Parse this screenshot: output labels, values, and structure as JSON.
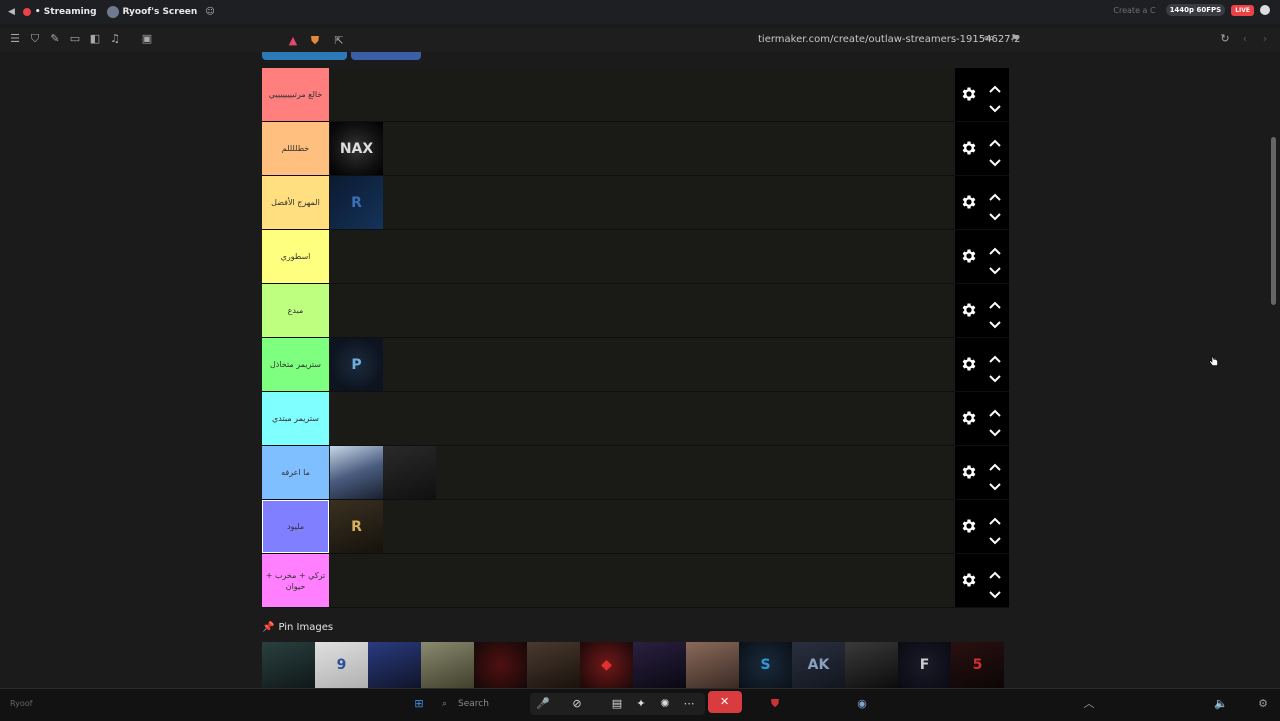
{
  "discord_bar": {
    "stream_label": "• Streaming",
    "screen_label": "Ryoof's Screen",
    "create_text": "Create a C",
    "quality": "1440p 60FPS",
    "live": "LIVE"
  },
  "browser": {
    "url": "tiermaker.com/create/outlaw-streamers-19154627-2"
  },
  "tiers": [
    {
      "label": "خالع مرتبيييييييي",
      "color": "#ff7f7f",
      "items": []
    },
    {
      "label": "خطللللم",
      "color": "#ffbf7f",
      "items": [
        "nax-logo"
      ]
    },
    {
      "label": "المهرج الأفضل",
      "color": "#ffdf7f",
      "items": [
        "blue-r-logo"
      ]
    },
    {
      "label": "اسطوري",
      "color": "#ffff7f",
      "items": []
    },
    {
      "label": "مبدع",
      "color": "#bfff7f",
      "items": []
    },
    {
      "label": "ستريمر متخاذل",
      "color": "#7fff7f",
      "items": [
        "pd-logo"
      ]
    },
    {
      "label": "ستريمر مبتدي",
      "color": "#7fffff",
      "items": []
    },
    {
      "label": "ما اعرفه",
      "color": "#7fbfff",
      "items": [
        "anime-avatar",
        "dark-avatar"
      ]
    },
    {
      "label": "مليود",
      "color": "#7f7fff",
      "items": [
        "gold-r-logo"
      ]
    },
    {
      "label": "تركي + مخرب + حيوان",
      "color": "#ff7fff",
      "items": []
    }
  ],
  "pin_images_label": "Pin Images",
  "pin_images": [
    "cat-mask",
    "f9-logo",
    "blue-hair",
    "soldier",
    "red-dark",
    "bearded-man",
    "red-mask",
    "purple-eyes",
    "woman",
    "s-logo",
    "ak-logo",
    "black-hair",
    "f-logo",
    "s5-logo"
  ],
  "taskbar": {
    "search_placeholder": "Search",
    "user_label": "Ryoof"
  },
  "colors": {
    "accent": "#3a84c9",
    "live_red": "#ed4245",
    "stop_red": "#d83c3e"
  }
}
